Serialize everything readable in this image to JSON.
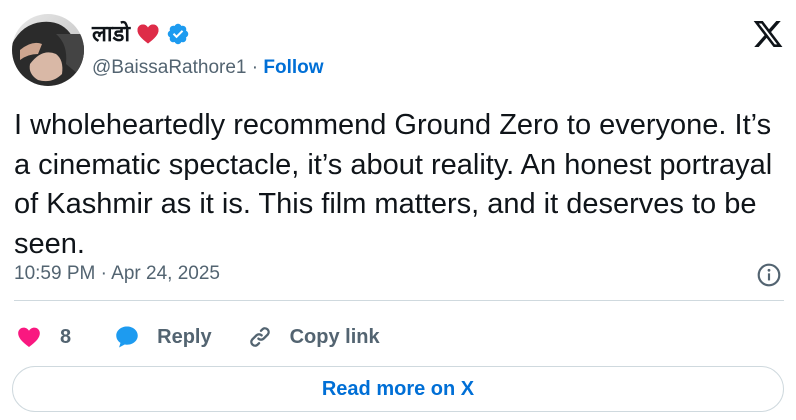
{
  "author": {
    "display_name": "लाडो",
    "handle": "@BaissaRathore1",
    "separator": "·",
    "follow_label": "Follow",
    "avatar_icon": "profile-photo",
    "badge_icon": "verified-badge-icon",
    "emoji_icon": "red-heart-emoji"
  },
  "platform": {
    "logo_icon": "x-logo-icon"
  },
  "tweet": {
    "text": "I wholeheartedly recommend Ground Zero to everyone. It’s a cinematic spectacle, it’s about reality. An honest portrayal of Kashmir as it is. This film matters, and it deserves to be seen.",
    "timestamp": "10:59 PM · Apr 24, 2025"
  },
  "actions": {
    "like_count": "8",
    "reply_label": "Reply",
    "copy_link_label": "Copy link"
  },
  "footer": {
    "read_more_label": "Read more on X"
  },
  "colors": {
    "accent": "#006fd6",
    "like": "#f91880",
    "reply": "#1d9bf0",
    "muted": "#536471",
    "verified": "#1d9bf0",
    "border": "#cfd9de"
  }
}
